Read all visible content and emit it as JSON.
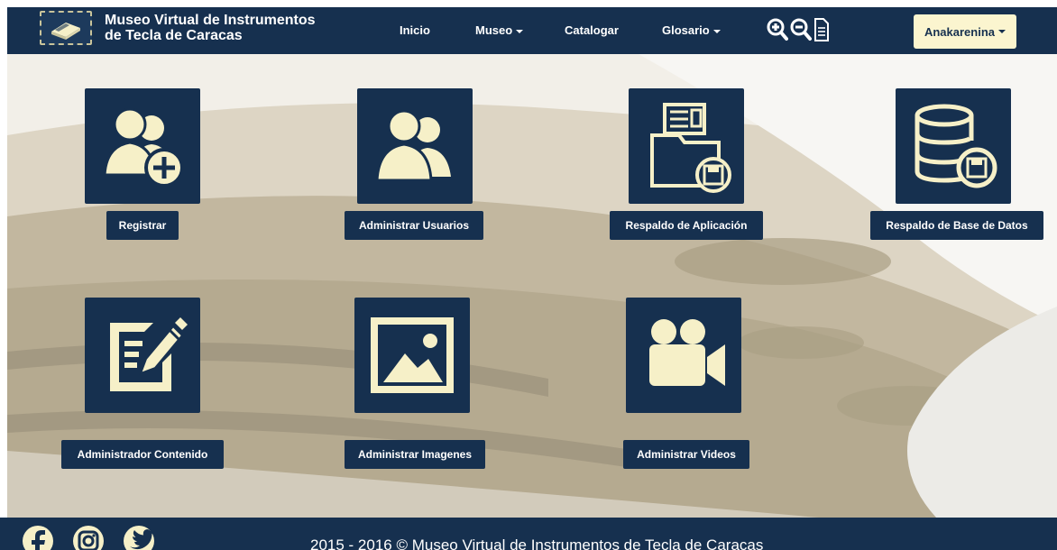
{
  "brand": {
    "title_line1": "Museo Virtual de Instrumentos",
    "title_line2": "de Tecla de Caracas",
    "logo_icon": "piano-book-icon"
  },
  "nav": {
    "items": [
      {
        "label": "Inicio",
        "dropdown": false
      },
      {
        "label": "Museo",
        "dropdown": true
      },
      {
        "label": "Catalogar",
        "dropdown": false
      },
      {
        "label": "Glosario",
        "dropdown": true
      }
    ],
    "icons": [
      "zoom-in-icon",
      "zoom-out-icon",
      "document-icon"
    ],
    "user": "Anakarenina"
  },
  "tiles": [
    {
      "label": "Registrar",
      "icon": "add-user-icon"
    },
    {
      "label": "Administrar Usuarios",
      "icon": "users-icon"
    },
    {
      "label": "Respaldo de Aplicación",
      "icon": "folder-backup-icon"
    },
    {
      "label": "Respaldo de Base de Datos",
      "icon": "database-backup-icon"
    },
    {
      "label": "Administrador Contenido",
      "icon": "edit-document-icon"
    },
    {
      "label": "Administrar Imagenes",
      "icon": "image-icon"
    },
    {
      "label": "Administrar Videos",
      "icon": "video-camera-icon"
    }
  ],
  "footer": {
    "copyright": "2015 - 2016 © Museo Virtual de Instrumentos de Tecla de Caracas",
    "social": [
      "facebook-icon",
      "instagram-icon",
      "twitter-icon"
    ]
  },
  "colors": {
    "navy": "#16304f",
    "cream": "#fbf5cf",
    "icon_fill": "#f6f0c8"
  }
}
